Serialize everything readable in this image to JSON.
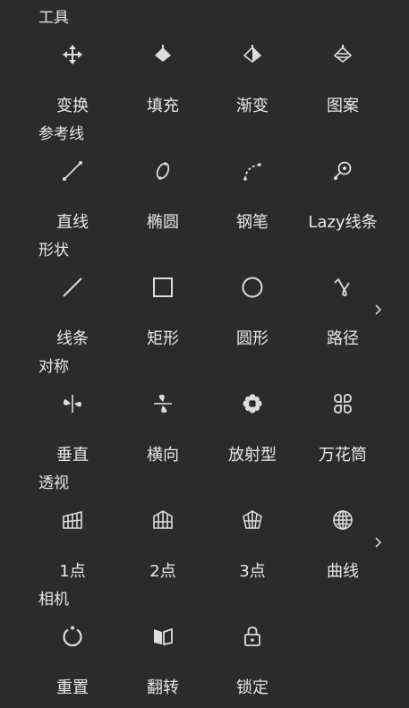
{
  "sections": [
    {
      "title": "工具",
      "items": [
        "变换",
        "填充",
        "渐变",
        "图案"
      ],
      "has_more": false
    },
    {
      "title": "参考线",
      "items": [
        "直线",
        "椭圆",
        "钢笔",
        "Lazy线条"
      ],
      "has_more": false
    },
    {
      "title": "形状",
      "items": [
        "线条",
        "矩形",
        "圆形",
        "路径"
      ],
      "has_more": true
    },
    {
      "title": "对称",
      "items": [
        "垂直",
        "横向",
        "放射型",
        "万花筒"
      ],
      "has_more": false
    },
    {
      "title": "透视",
      "items": [
        "1点",
        "2点",
        "3点",
        "曲线"
      ],
      "has_more": true
    },
    {
      "title": "相机",
      "items": [
        "重置",
        "翻转",
        "锁定"
      ],
      "has_more": false
    }
  ],
  "colors": {
    "background": "#2b2b2b",
    "text": "#e8e8e8",
    "icon": "#dcdcdc"
  }
}
